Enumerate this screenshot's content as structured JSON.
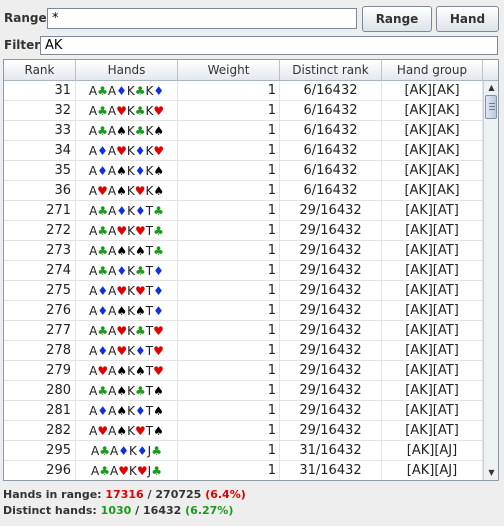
{
  "range": {
    "label": "Range:",
    "value": "*"
  },
  "buttons": {
    "range": "Range",
    "hand": "Hand"
  },
  "filter": {
    "label": "Filter:",
    "value": "AK"
  },
  "table": {
    "columns": [
      "Rank",
      "Hands",
      "Weight",
      "Distinct rank",
      "Hand group"
    ],
    "rows": [
      {
        "rank": "31",
        "hand": "A♣A♦K♣K♦",
        "weight": "1",
        "distinct": "6/16432",
        "group": "[AK][AK]"
      },
      {
        "rank": "32",
        "hand": "A♣A♥K♣K♥",
        "weight": "1",
        "distinct": "6/16432",
        "group": "[AK][AK]"
      },
      {
        "rank": "33",
        "hand": "A♣A♠K♣K♠",
        "weight": "1",
        "distinct": "6/16432",
        "group": "[AK][AK]"
      },
      {
        "rank": "34",
        "hand": "A♦A♥K♦K♥",
        "weight": "1",
        "distinct": "6/16432",
        "group": "[AK][AK]"
      },
      {
        "rank": "35",
        "hand": "A♦A♠K♦K♠",
        "weight": "1",
        "distinct": "6/16432",
        "group": "[AK][AK]"
      },
      {
        "rank": "36",
        "hand": "A♥A♠K♥K♠",
        "weight": "1",
        "distinct": "6/16432",
        "group": "[AK][AK]"
      },
      {
        "rank": "271",
        "hand": "A♣A♦K♦T♣",
        "weight": "1",
        "distinct": "29/16432",
        "group": "[AK][AT]"
      },
      {
        "rank": "272",
        "hand": "A♣A♥K♥T♣",
        "weight": "1",
        "distinct": "29/16432",
        "group": "[AK][AT]"
      },
      {
        "rank": "273",
        "hand": "A♣A♠K♠T♣",
        "weight": "1",
        "distinct": "29/16432",
        "group": "[AK][AT]"
      },
      {
        "rank": "274",
        "hand": "A♣A♦K♣T♦",
        "weight": "1",
        "distinct": "29/16432",
        "group": "[AK][AT]"
      },
      {
        "rank": "275",
        "hand": "A♦A♥K♥T♦",
        "weight": "1",
        "distinct": "29/16432",
        "group": "[AK][AT]"
      },
      {
        "rank": "276",
        "hand": "A♦A♠K♠T♦",
        "weight": "1",
        "distinct": "29/16432",
        "group": "[AK][AT]"
      },
      {
        "rank": "277",
        "hand": "A♣A♥K♣T♥",
        "weight": "1",
        "distinct": "29/16432",
        "group": "[AK][AT]"
      },
      {
        "rank": "278",
        "hand": "A♦A♥K♦T♥",
        "weight": "1",
        "distinct": "29/16432",
        "group": "[AK][AT]"
      },
      {
        "rank": "279",
        "hand": "A♥A♠K♠T♥",
        "weight": "1",
        "distinct": "29/16432",
        "group": "[AK][AT]"
      },
      {
        "rank": "280",
        "hand": "A♣A♠K♣T♠",
        "weight": "1",
        "distinct": "29/16432",
        "group": "[AK][AT]"
      },
      {
        "rank": "281",
        "hand": "A♦A♠K♦T♠",
        "weight": "1",
        "distinct": "29/16432",
        "group": "[AK][AT]"
      },
      {
        "rank": "282",
        "hand": "A♥A♠K♥T♠",
        "weight": "1",
        "distinct": "29/16432",
        "group": "[AK][AT]"
      },
      {
        "rank": "295",
        "hand": "A♣A♦K♦J♣",
        "weight": "1",
        "distinct": "31/16432",
        "group": "[AK][AJ]"
      },
      {
        "rank": "296",
        "hand": "A♣A♥K♥J♣",
        "weight": "1",
        "distinct": "31/16432",
        "group": "[AK][AJ]"
      }
    ]
  },
  "stats": {
    "hands_label": "Hands in range:",
    "hands_count": "17316",
    "hands_sep": "/",
    "hands_total": "270725",
    "hands_pct": "(6.4%)",
    "distinct_label": "Distinct hands:",
    "distinct_count": "1030",
    "distinct_sep": "/",
    "distinct_total": "16432",
    "distinct_pct": "(6.27%)"
  },
  "colors": {
    "clubs": "#1a9a1a",
    "diamonds": "#1030e0",
    "hearts": "#e00000",
    "spades": "#000000"
  }
}
